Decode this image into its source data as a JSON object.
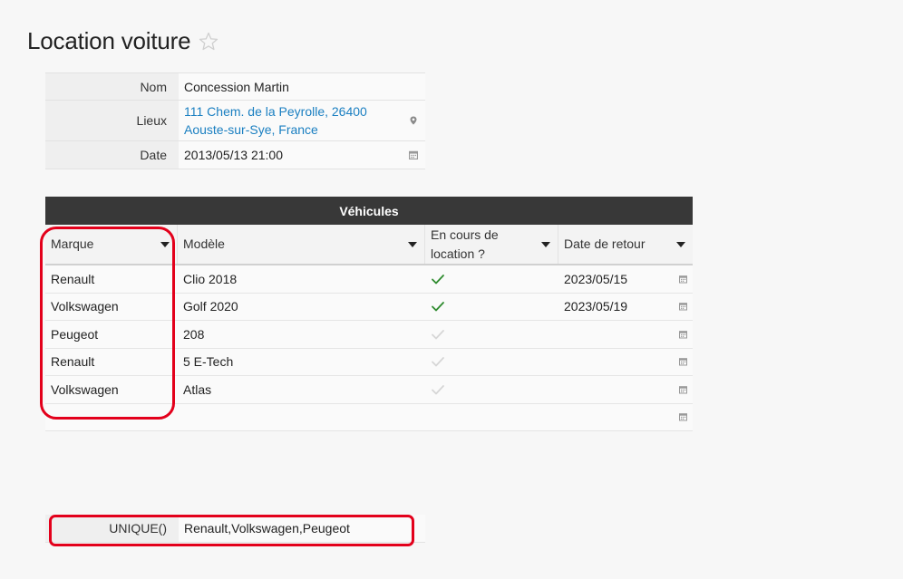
{
  "page": {
    "title": "Location voiture"
  },
  "form": {
    "fields": [
      {
        "label": "Nom",
        "value": "Concession Martin"
      },
      {
        "label": "Lieux",
        "value_line1": "111 Chem. de la Peyrolle, 26400",
        "value_line2": "Aouste-sur-Sye, France"
      },
      {
        "label": "Date",
        "value": "2013/05/13 21:00"
      }
    ]
  },
  "table": {
    "title": "Véhicules",
    "columns": [
      "Marque",
      "Modèle",
      "En cours de location ?",
      "Date de retour"
    ],
    "col3_line1": "En cours de",
    "col3_line2": "location ?",
    "rows": [
      {
        "marque": "Renault",
        "modele": "Clio 2018",
        "en_cours": true,
        "retour": "2023/05/15"
      },
      {
        "marque": "Volkswagen",
        "modele": "Golf 2020",
        "en_cours": true,
        "retour": "2023/05/19"
      },
      {
        "marque": "Peugeot",
        "modele": "208",
        "en_cours": false,
        "retour": ""
      },
      {
        "marque": "Renault",
        "modele": "5 E-Tech",
        "en_cours": false,
        "retour": ""
      },
      {
        "marque": "Volkswagen",
        "modele": "Atlas",
        "en_cours": false,
        "retour": ""
      },
      {
        "marque": "",
        "modele": "",
        "en_cours": null,
        "retour": ""
      }
    ]
  },
  "formula": {
    "label": "UNIQUE()",
    "value": "Renault,Volkswagen,Peugeot"
  },
  "colors": {
    "highlight": "#e3001b",
    "link": "#1a7fc1",
    "check_on": "#2e8b2e",
    "check_off": "#d6d6d6",
    "table_header_bg": "#383838"
  },
  "icons": {
    "favorite": "star-outline-icon",
    "location": "map-pin-icon",
    "date": "calendar-icon",
    "sort": "caret-down-icon",
    "checked": "checkmark-icon"
  }
}
